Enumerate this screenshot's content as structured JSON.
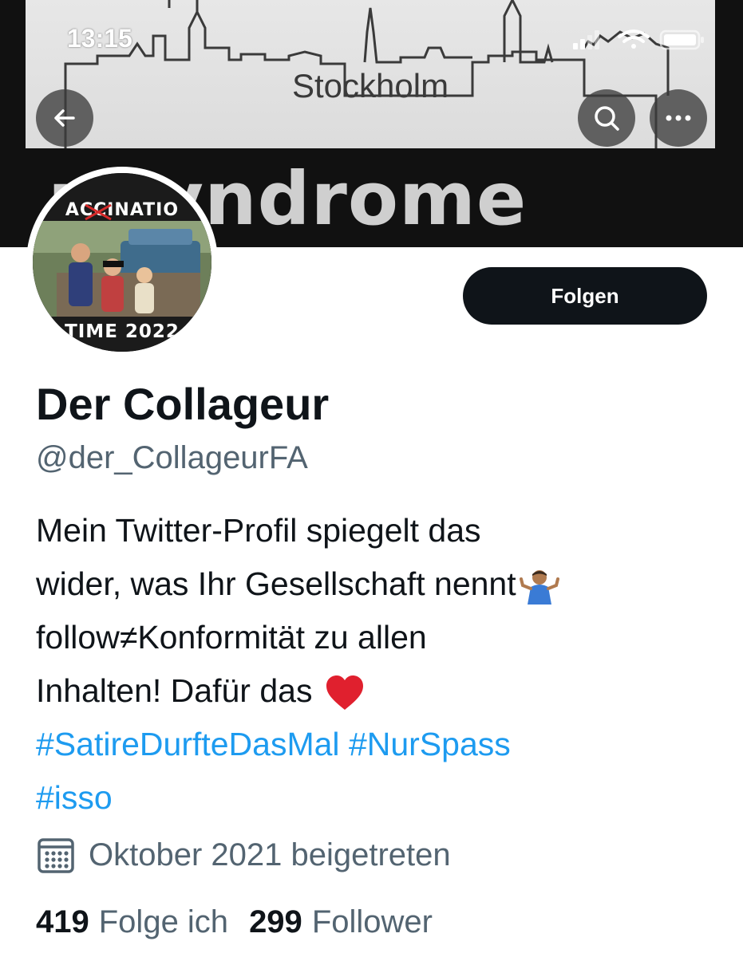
{
  "status_bar": {
    "time": "13:15",
    "icons": [
      "cellular-signal-icon",
      "wifi-icon",
      "battery-icon"
    ]
  },
  "banner": {
    "city": "Stockholm",
    "headline": "r syndrome"
  },
  "avatar": {
    "top_text": "ACCINATIO",
    "bottom_text": "TIME 2022"
  },
  "header": {
    "back_icon": "arrow-left-icon",
    "search_icon": "search-icon",
    "more_icon": "more-icon"
  },
  "actions": {
    "follow_label": "Folgen"
  },
  "profile": {
    "name": "Der Collageur",
    "handle": "@der_CollageurFA",
    "bio_lines": [
      "Mein Twitter-Profil spiegelt das",
      "wider, was Ihr Gesellschaft nennt",
      "follow≠Konformität zu allen",
      "Inhalten! Dafür das"
    ],
    "bio_emojis": [
      "shrugging-person-emoji",
      "red-heart-emoji"
    ],
    "hashtags_line1": [
      "#SatireDurfteDasMal",
      "#NurSpass"
    ],
    "hashtags_line2": [
      "#isso"
    ],
    "joined": "Oktober 2021 beigetreten"
  },
  "stats": {
    "following_count": "419",
    "following_label": "Folge ich",
    "followers_count": "299",
    "followers_label": "Follower"
  },
  "colors": {
    "text": "#0f1419",
    "secondary": "#536471",
    "link": "#1d9bf0",
    "button": "#0f1419"
  }
}
